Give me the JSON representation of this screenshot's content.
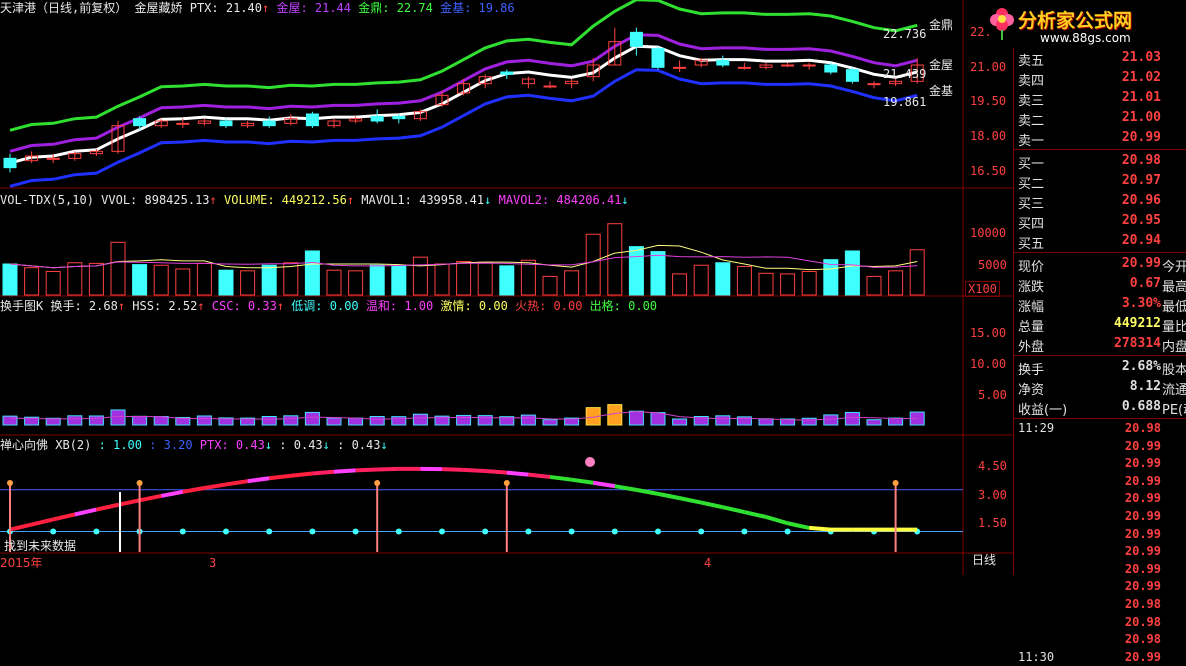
{
  "logo": {
    "title": "分析家公式网",
    "url": "www.88gs.com"
  },
  "price_header": {
    "stock": "天津港（日线,前复权）",
    "indicator": "金屋藏娇",
    "ptx_label": "PTX: 21.40",
    "jinwu_label": "金屋: 21.44",
    "jinding_label": "金鼎: 22.74",
    "jinji_label": "金基: 19.86"
  },
  "price_right_labels": {
    "jinding_val": "22.736",
    "jinding": "金鼎",
    "jinwu_val": "21.439",
    "jinwu": "金屋",
    "jinji": "金基",
    "jinji_val": "19.861"
  },
  "price_axis": [
    "22.",
    "21.00",
    "19.50",
    "18.00",
    "16.50"
  ],
  "vol_header": {
    "name": "VOL-TDX(5,10)",
    "vvol": "VVOL: 898425.13",
    "volume": "VOLUME: 449212.56",
    "mavol1": "MAVOL1: 439958.41",
    "mavol2": "MAVOL2: 484206.41",
    "arrow_up": "↑",
    "arrow_down": "↓"
  },
  "vol_axis": [
    "10000",
    "5000"
  ],
  "vol_unit": "X100",
  "turn_header": {
    "name": "换手图K",
    "huanshou": "换手: 2.68",
    "hss": "HSS: 2.52",
    "csc": "CSC: 0.33",
    "didiao": "低调: 0.00",
    "wenhe": "温和: 1.00",
    "jiqing": "激情: 0.00",
    "huore": "火热: 0.00",
    "chuge": "出格: 0.00",
    "arrow": "↑"
  },
  "turn_axis": [
    "15.00",
    "10.00",
    "5.00"
  ],
  "xb_header": {
    "name": "禅心向佛",
    "xb": "XB(2)",
    "v1": ": 1.00",
    "v2": ": 3.20",
    "ptx": "PTX: 0.43",
    "v4": ": 0.43",
    "v5": ": 0.43",
    "arrow": "↓"
  },
  "xb_axis": [
    "4.50",
    "3.00",
    "1.50"
  ],
  "bottom": {
    "year": "2015年",
    "m3": "3",
    "m4": "4",
    "future": "找到未来数据",
    "period": "日线"
  },
  "quote": {
    "asks": [
      {
        "label": "卖五",
        "value": "21.03"
      },
      {
        "label": "卖四",
        "value": "21.02"
      },
      {
        "label": "卖三",
        "value": "21.01"
      },
      {
        "label": "卖二",
        "value": "21.00"
      },
      {
        "label": "卖一",
        "value": "20.99"
      }
    ],
    "bids": [
      {
        "label": "买一",
        "value": "20.98"
      },
      {
        "label": "买二",
        "value": "20.97"
      },
      {
        "label": "买三",
        "value": "20.96"
      },
      {
        "label": "买四",
        "value": "20.95"
      },
      {
        "label": "买五",
        "value": "20.94"
      }
    ],
    "stats1": [
      {
        "label": "现价",
        "value": "20.99",
        "label2": "今开"
      },
      {
        "label": "涨跌",
        "value": "0.67",
        "label2": "最高"
      },
      {
        "label": "涨幅",
        "value": "3.30%",
        "label2": "最低"
      },
      {
        "label": "总量",
        "value": "449212",
        "label2": "量比"
      },
      {
        "label": "外盘",
        "value": "278314",
        "label2": "内盘"
      }
    ],
    "stats2": [
      {
        "label": "换手",
        "value": "2.68%",
        "label2": "股本"
      },
      {
        "label": "净资",
        "value": "8.12",
        "label2": "流通"
      },
      {
        "label": "收益(一)",
        "value": "0.688",
        "label2": "PE(动)"
      }
    ],
    "ticks": [
      {
        "time": "11:29",
        "price": "20.98"
      },
      {
        "time": "",
        "price": "20.99"
      },
      {
        "time": "",
        "price": "20.99"
      },
      {
        "time": "",
        "price": "20.99"
      },
      {
        "time": "",
        "price": "20.99"
      },
      {
        "time": "",
        "price": "20.99"
      },
      {
        "time": "",
        "price": "20.99"
      },
      {
        "time": "",
        "price": "20.99"
      },
      {
        "time": "",
        "price": "20.99"
      },
      {
        "time": "",
        "price": "20.99"
      },
      {
        "time": "",
        "price": "20.98"
      },
      {
        "time": "",
        "price": "20.98"
      },
      {
        "time": "",
        "price": "20.98"
      },
      {
        "time": "11:30",
        "price": "20.99"
      }
    ]
  },
  "chart_data": {
    "type": "candlestick",
    "candles": [
      {
        "o": 17.0,
        "c": 16.6,
        "h": 17.2,
        "l": 16.4
      },
      {
        "o": 16.9,
        "c": 17.1,
        "h": 17.3,
        "l": 16.8
      },
      {
        "o": 17.0,
        "c": 17.0,
        "h": 17.2,
        "l": 16.8
      },
      {
        "o": 17.0,
        "c": 17.2,
        "h": 17.3,
        "l": 16.9
      },
      {
        "o": 17.2,
        "c": 17.3,
        "h": 17.4,
        "l": 17.1
      },
      {
        "o": 17.3,
        "c": 18.4,
        "h": 18.6,
        "l": 17.2
      },
      {
        "o": 18.7,
        "c": 18.4,
        "h": 18.8,
        "l": 18.2
      },
      {
        "o": 18.4,
        "c": 18.6,
        "h": 18.7,
        "l": 18.3
      },
      {
        "o": 18.5,
        "c": 18.5,
        "h": 18.7,
        "l": 18.3
      },
      {
        "o": 18.5,
        "c": 18.6,
        "h": 18.7,
        "l": 18.4
      },
      {
        "o": 18.6,
        "c": 18.4,
        "h": 18.7,
        "l": 18.3
      },
      {
        "o": 18.4,
        "c": 18.5,
        "h": 18.6,
        "l": 18.3
      },
      {
        "o": 18.6,
        "c": 18.4,
        "h": 18.8,
        "l": 18.3
      },
      {
        "o": 18.5,
        "c": 18.7,
        "h": 18.9,
        "l": 18.4
      },
      {
        "o": 18.9,
        "c": 18.4,
        "h": 19.0,
        "l": 18.3
      },
      {
        "o": 18.4,
        "c": 18.6,
        "h": 18.7,
        "l": 18.3
      },
      {
        "o": 18.6,
        "c": 18.7,
        "h": 18.8,
        "l": 18.5
      },
      {
        "o": 18.8,
        "c": 18.6,
        "h": 19.1,
        "l": 18.5
      },
      {
        "o": 18.8,
        "c": 18.7,
        "h": 18.9,
        "l": 18.5
      },
      {
        "o": 18.7,
        "c": 19.0,
        "h": 19.1,
        "l": 18.6
      },
      {
        "o": 19.3,
        "c": 19.7,
        "h": 19.9,
        "l": 19.2
      },
      {
        "o": 19.8,
        "c": 20.2,
        "h": 20.4,
        "l": 19.7
      },
      {
        "o": 20.2,
        "c": 20.5,
        "h": 20.6,
        "l": 20.0
      },
      {
        "o": 20.7,
        "c": 20.6,
        "h": 20.8,
        "l": 20.4
      },
      {
        "o": 20.2,
        "c": 20.4,
        "h": 20.5,
        "l": 20.0
      },
      {
        "o": 20.1,
        "c": 20.1,
        "h": 20.3,
        "l": 20.0
      },
      {
        "o": 20.2,
        "c": 20.3,
        "h": 20.4,
        "l": 20.0
      },
      {
        "o": 20.5,
        "c": 21.0,
        "h": 21.3,
        "l": 20.3
      },
      {
        "o": 21.0,
        "c": 22.0,
        "h": 22.6,
        "l": 21.0
      },
      {
        "o": 22.4,
        "c": 21.8,
        "h": 22.6,
        "l": 21.4
      },
      {
        "o": 21.7,
        "c": 20.9,
        "h": 21.8,
        "l": 20.8
      },
      {
        "o": 20.9,
        "c": 20.9,
        "h": 21.2,
        "l": 20.7
      },
      {
        "o": 21.0,
        "c": 21.2,
        "h": 21.3,
        "l": 20.9
      },
      {
        "o": 21.2,
        "c": 21.0,
        "h": 21.4,
        "l": 20.9
      },
      {
        "o": 20.9,
        "c": 20.9,
        "h": 21.1,
        "l": 20.8
      },
      {
        "o": 20.9,
        "c": 21.0,
        "h": 21.1,
        "l": 20.8
      },
      {
        "o": 21.0,
        "c": 21.0,
        "h": 21.1,
        "l": 20.9
      },
      {
        "o": 21.0,
        "c": 21.0,
        "h": 21.1,
        "l": 20.8
      },
      {
        "o": 21.0,
        "c": 20.7,
        "h": 21.1,
        "l": 20.6
      },
      {
        "o": 20.8,
        "c": 20.3,
        "h": 20.9,
        "l": 20.2
      },
      {
        "o": 20.2,
        "c": 20.2,
        "h": 20.3,
        "l": 20.0
      },
      {
        "o": 20.2,
        "c": 20.3,
        "h": 20.4,
        "l": 20.1
      },
      {
        "o": 20.3,
        "c": 21.0,
        "h": 21.3,
        "l": 20.2
      }
    ]
  }
}
